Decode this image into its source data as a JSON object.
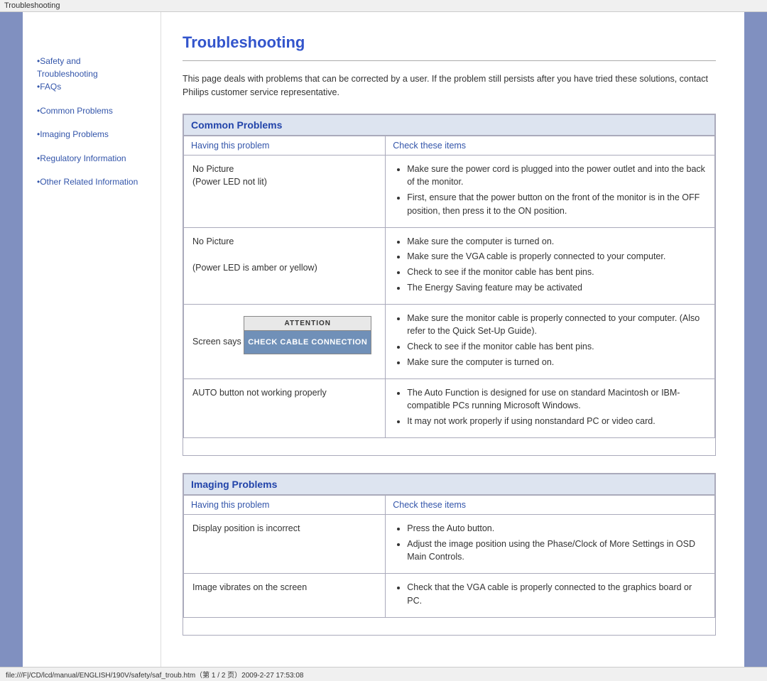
{
  "title_bar": "Troubleshooting",
  "sidebar": {
    "group1": [
      {
        "label": "•Safety and Troubleshooting",
        "href": "#"
      },
      {
        "label": "•FAQs",
        "href": "#"
      }
    ],
    "group2": [
      {
        "label": "•Common Problems",
        "href": "#"
      },
      {
        "label": "•Imaging Problems",
        "href": "#"
      }
    ],
    "group3": [
      {
        "label": "•Regulatory Information",
        "href": "#"
      },
      {
        "label": "•Other Related Information",
        "href": "#"
      }
    ]
  },
  "page": {
    "title": "Troubleshooting",
    "intro": "This page deals with problems that can be corrected by a user. If the problem still persists after you have tried these solutions, contact Philips customer service representative."
  },
  "common_problems": {
    "heading": "Common Problems",
    "col1": "Having this problem",
    "col2": "Check these items",
    "rows": [
      {
        "problem": "No Picture\n(Power LED not lit)",
        "checks": [
          "Make sure the power cord is plugged into the power outlet and into the back of the monitor.",
          "First, ensure that the power button on the front of the monitor is in the OFF position, then press it to the ON position."
        ],
        "has_attention": false
      },
      {
        "problem": "No Picture\n\n(Power LED is amber or yellow)",
        "checks": [
          "Make sure the computer is turned on.",
          "Make sure the VGA cable is properly connected to your computer.",
          "Check to see if the monitor cable has bent pins.",
          "The Energy Saving feature may be activated"
        ],
        "has_attention": false
      },
      {
        "problem": "Screen says",
        "attention_header": "ATTENTION",
        "attention_body": "CHECK CABLE CONNECTION",
        "checks": [
          "Make sure the monitor cable is properly connected to your computer. (Also refer to the Quick Set-Up Guide).",
          "Check to see if the monitor cable has bent pins.",
          "Make sure the computer is turned on."
        ],
        "has_attention": true
      },
      {
        "problem": "AUTO button not working properly",
        "checks": [
          "The Auto Function is designed for use on standard Macintosh or IBM-compatible PCs running Microsoft Windows.",
          "It may not work properly if using nonstandard PC or video card."
        ],
        "has_attention": false
      }
    ]
  },
  "imaging_problems": {
    "heading": "Imaging Problems",
    "col1": "Having this problem",
    "col2": "Check these items",
    "rows": [
      {
        "problem": "Display position is incorrect",
        "checks": [
          "Press the Auto button.",
          "Adjust the image position using the Phase/Clock of More Settings in OSD Main Controls."
        ],
        "has_attention": false
      },
      {
        "problem": "Image vibrates on the screen",
        "checks": [
          "Check that the VGA cable is properly connected to the graphics board or PC."
        ],
        "has_attention": false
      }
    ]
  },
  "status_bar": "file:///F|/CD/lcd/manual/ENGLISH/190V/safety/saf_troub.htm（第 1 / 2 页）2009-2-27 17:53:08"
}
